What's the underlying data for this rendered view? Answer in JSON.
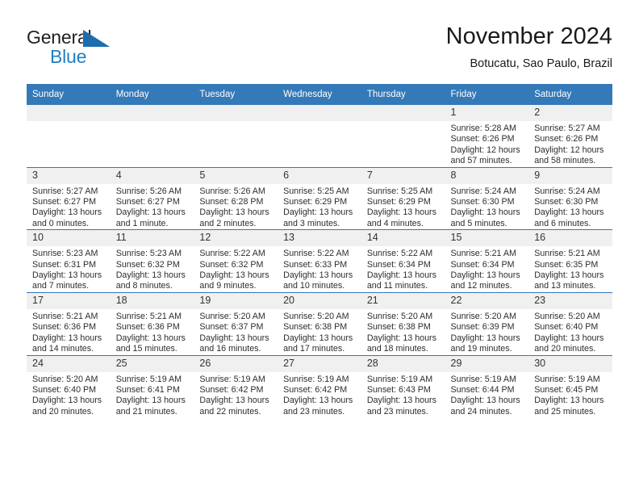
{
  "brand": {
    "line1": "General",
    "line2": "Blue",
    "logo_icon": "triangle-flag-icon"
  },
  "header": {
    "title": "November 2024",
    "subtitle": "Botucatu, Sao Paulo, Brazil"
  },
  "colors": {
    "header_blue": "#3479b8",
    "brand_blue": "#1f7fc4",
    "daynum_bg": "#f0f0f0",
    "text": "#2d2d2d"
  },
  "weekdays": [
    "Sunday",
    "Monday",
    "Tuesday",
    "Wednesday",
    "Thursday",
    "Friday",
    "Saturday"
  ],
  "labels": {
    "sunrise_prefix": "Sunrise:",
    "sunset_prefix": "Sunset:",
    "daylight_prefix": "Daylight:"
  },
  "weeks": [
    [
      {
        "day": "",
        "sunrise": "",
        "sunset": "",
        "daylight": "",
        "empty": true
      },
      {
        "day": "",
        "sunrise": "",
        "sunset": "",
        "daylight": "",
        "empty": true
      },
      {
        "day": "",
        "sunrise": "",
        "sunset": "",
        "daylight": "",
        "empty": true
      },
      {
        "day": "",
        "sunrise": "",
        "sunset": "",
        "daylight": "",
        "empty": true
      },
      {
        "day": "",
        "sunrise": "",
        "sunset": "",
        "daylight": "",
        "empty": true
      },
      {
        "day": "1",
        "sunrise": "Sunrise: 5:28 AM",
        "sunset": "Sunset: 6:26 PM",
        "daylight": "Daylight: 12 hours and 57 minutes.",
        "empty": false
      },
      {
        "day": "2",
        "sunrise": "Sunrise: 5:27 AM",
        "sunset": "Sunset: 6:26 PM",
        "daylight": "Daylight: 12 hours and 58 minutes.",
        "empty": false
      }
    ],
    [
      {
        "day": "3",
        "sunrise": "Sunrise: 5:27 AM",
        "sunset": "Sunset: 6:27 PM",
        "daylight": "Daylight: 13 hours and 0 minutes.",
        "empty": false
      },
      {
        "day": "4",
        "sunrise": "Sunrise: 5:26 AM",
        "sunset": "Sunset: 6:27 PM",
        "daylight": "Daylight: 13 hours and 1 minute.",
        "empty": false
      },
      {
        "day": "5",
        "sunrise": "Sunrise: 5:26 AM",
        "sunset": "Sunset: 6:28 PM",
        "daylight": "Daylight: 13 hours and 2 minutes.",
        "empty": false
      },
      {
        "day": "6",
        "sunrise": "Sunrise: 5:25 AM",
        "sunset": "Sunset: 6:29 PM",
        "daylight": "Daylight: 13 hours and 3 minutes.",
        "empty": false
      },
      {
        "day": "7",
        "sunrise": "Sunrise: 5:25 AM",
        "sunset": "Sunset: 6:29 PM",
        "daylight": "Daylight: 13 hours and 4 minutes.",
        "empty": false
      },
      {
        "day": "8",
        "sunrise": "Sunrise: 5:24 AM",
        "sunset": "Sunset: 6:30 PM",
        "daylight": "Daylight: 13 hours and 5 minutes.",
        "empty": false
      },
      {
        "day": "9",
        "sunrise": "Sunrise: 5:24 AM",
        "sunset": "Sunset: 6:30 PM",
        "daylight": "Daylight: 13 hours and 6 minutes.",
        "empty": false
      }
    ],
    [
      {
        "day": "10",
        "sunrise": "Sunrise: 5:23 AM",
        "sunset": "Sunset: 6:31 PM",
        "daylight": "Daylight: 13 hours and 7 minutes.",
        "empty": false
      },
      {
        "day": "11",
        "sunrise": "Sunrise: 5:23 AM",
        "sunset": "Sunset: 6:32 PM",
        "daylight": "Daylight: 13 hours and 8 minutes.",
        "empty": false
      },
      {
        "day": "12",
        "sunrise": "Sunrise: 5:22 AM",
        "sunset": "Sunset: 6:32 PM",
        "daylight": "Daylight: 13 hours and 9 minutes.",
        "empty": false
      },
      {
        "day": "13",
        "sunrise": "Sunrise: 5:22 AM",
        "sunset": "Sunset: 6:33 PM",
        "daylight": "Daylight: 13 hours and 10 minutes.",
        "empty": false
      },
      {
        "day": "14",
        "sunrise": "Sunrise: 5:22 AM",
        "sunset": "Sunset: 6:34 PM",
        "daylight": "Daylight: 13 hours and 11 minutes.",
        "empty": false
      },
      {
        "day": "15",
        "sunrise": "Sunrise: 5:21 AM",
        "sunset": "Sunset: 6:34 PM",
        "daylight": "Daylight: 13 hours and 12 minutes.",
        "empty": false
      },
      {
        "day": "16",
        "sunrise": "Sunrise: 5:21 AM",
        "sunset": "Sunset: 6:35 PM",
        "daylight": "Daylight: 13 hours and 13 minutes.",
        "empty": false
      }
    ],
    [
      {
        "day": "17",
        "sunrise": "Sunrise: 5:21 AM",
        "sunset": "Sunset: 6:36 PM",
        "daylight": "Daylight: 13 hours and 14 minutes.",
        "empty": false
      },
      {
        "day": "18",
        "sunrise": "Sunrise: 5:21 AM",
        "sunset": "Sunset: 6:36 PM",
        "daylight": "Daylight: 13 hours and 15 minutes.",
        "empty": false
      },
      {
        "day": "19",
        "sunrise": "Sunrise: 5:20 AM",
        "sunset": "Sunset: 6:37 PM",
        "daylight": "Daylight: 13 hours and 16 minutes.",
        "empty": false
      },
      {
        "day": "20",
        "sunrise": "Sunrise: 5:20 AM",
        "sunset": "Sunset: 6:38 PM",
        "daylight": "Daylight: 13 hours and 17 minutes.",
        "empty": false
      },
      {
        "day": "21",
        "sunrise": "Sunrise: 5:20 AM",
        "sunset": "Sunset: 6:38 PM",
        "daylight": "Daylight: 13 hours and 18 minutes.",
        "empty": false
      },
      {
        "day": "22",
        "sunrise": "Sunrise: 5:20 AM",
        "sunset": "Sunset: 6:39 PM",
        "daylight": "Daylight: 13 hours and 19 minutes.",
        "empty": false
      },
      {
        "day": "23",
        "sunrise": "Sunrise: 5:20 AM",
        "sunset": "Sunset: 6:40 PM",
        "daylight": "Daylight: 13 hours and 20 minutes.",
        "empty": false
      }
    ],
    [
      {
        "day": "24",
        "sunrise": "Sunrise: 5:20 AM",
        "sunset": "Sunset: 6:40 PM",
        "daylight": "Daylight: 13 hours and 20 minutes.",
        "empty": false
      },
      {
        "day": "25",
        "sunrise": "Sunrise: 5:19 AM",
        "sunset": "Sunset: 6:41 PM",
        "daylight": "Daylight: 13 hours and 21 minutes.",
        "empty": false
      },
      {
        "day": "26",
        "sunrise": "Sunrise: 5:19 AM",
        "sunset": "Sunset: 6:42 PM",
        "daylight": "Daylight: 13 hours and 22 minutes.",
        "empty": false
      },
      {
        "day": "27",
        "sunrise": "Sunrise: 5:19 AM",
        "sunset": "Sunset: 6:42 PM",
        "daylight": "Daylight: 13 hours and 23 minutes.",
        "empty": false
      },
      {
        "day": "28",
        "sunrise": "Sunrise: 5:19 AM",
        "sunset": "Sunset: 6:43 PM",
        "daylight": "Daylight: 13 hours and 23 minutes.",
        "empty": false
      },
      {
        "day": "29",
        "sunrise": "Sunrise: 5:19 AM",
        "sunset": "Sunset: 6:44 PM",
        "daylight": "Daylight: 13 hours and 24 minutes.",
        "empty": false
      },
      {
        "day": "30",
        "sunrise": "Sunrise: 5:19 AM",
        "sunset": "Sunset: 6:45 PM",
        "daylight": "Daylight: 13 hours and 25 minutes.",
        "empty": false
      }
    ]
  ]
}
